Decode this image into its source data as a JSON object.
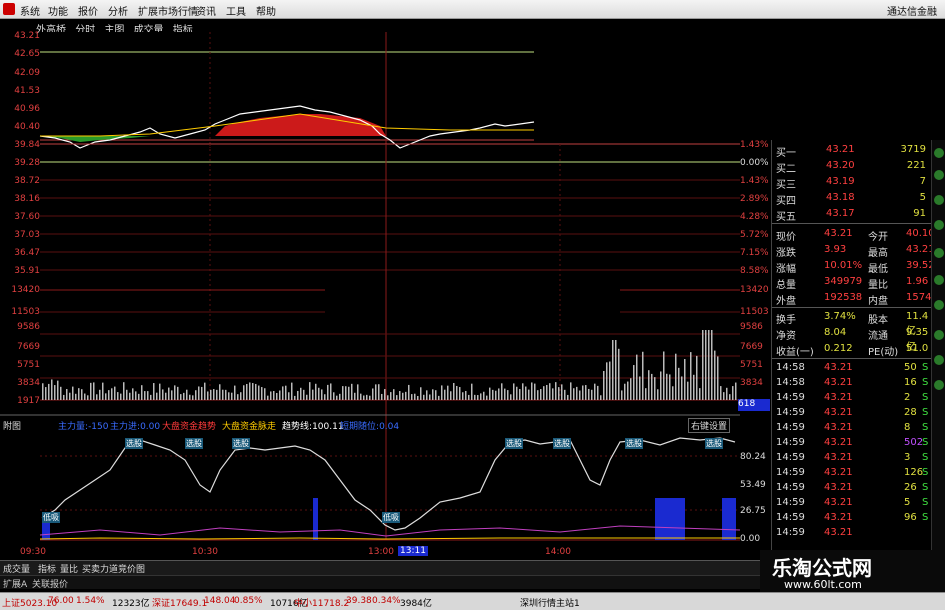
{
  "menu": {
    "items": [
      "系统",
      "功能",
      "报价",
      "分析",
      "扩展市场行情",
      "资讯",
      "工具",
      "帮助"
    ],
    "brand": "通达信金融"
  },
  "tabs": [
    "外高桥",
    "分时",
    "主图",
    "成交量",
    "指标"
  ],
  "price_axis": {
    "left": [
      "43.21",
      "42.65",
      "42.09",
      "41.53",
      "40.96",
      "40.40",
      "39.84",
      "39.28",
      "38.72",
      "38.16",
      "37.60",
      "37.03",
      "36.47",
      "35.91"
    ],
    "pct": [
      "1.43%",
      "0.00%",
      "1.43%",
      "2.89%",
      "4.28%",
      "5.72%",
      "7.15%",
      "8.58%"
    ]
  },
  "vol_axis": {
    "left": [
      "13420",
      "11503",
      "9586",
      "7669",
      "5751",
      "3834",
      "1917"
    ],
    "right": [
      "13420",
      "11503",
      "9586",
      "7669",
      "5751",
      "3834"
    ],
    "last": "618"
  },
  "indicator": {
    "title": "附图",
    "items": [
      {
        "label": "主力量",
        "value": "-150",
        "color": "#3a6cff"
      },
      {
        "label": "主力进",
        "value": "0.00",
        "color": "#3a6cff"
      },
      {
        "label": "大盘资金趋势",
        "value": "",
        "color": "#ff3a3a"
      },
      {
        "label": "大盘资金脉走",
        "value": "",
        "color": "#ffcc00"
      },
      {
        "label": "趋势线",
        "value": "100.11",
        "color": "#ffffff"
      },
      {
        "label": "短期随位",
        "value": "0.04",
        "color": "#3a6cff"
      }
    ],
    "right_btn": "右键设置",
    "axis": [
      "80.24",
      "53.49",
      "26.75",
      "0.00"
    ],
    "tags": [
      "选股",
      "选股",
      "选股",
      "选股",
      "选股",
      "选股",
      "选股",
      "低吸",
      "低吸"
    ]
  },
  "time_axis": [
    "09:30",
    "10:30",
    "13:00",
    "13:11",
    "14:00"
  ],
  "quote": {
    "bids": [
      {
        "label": "买一",
        "price": "43.21",
        "vol": "3719"
      },
      {
        "label": "买二",
        "price": "43.20",
        "vol": "221"
      },
      {
        "label": "买三",
        "price": "43.19",
        "vol": "7"
      },
      {
        "label": "买四",
        "price": "43.18",
        "vol": "5"
      },
      {
        "label": "买五",
        "price": "43.17",
        "vol": "91"
      }
    ],
    "stats": [
      {
        "a": "现价",
        "av": "43.21",
        "b": "今开",
        "bv": "40.10"
      },
      {
        "a": "涨跌",
        "av": "3.93",
        "b": "最高",
        "bv": "43.21"
      },
      {
        "a": "涨幅",
        "av": "10.01%",
        "b": "最低",
        "bv": "39.52"
      },
      {
        "a": "总量",
        "av": "349979",
        "b": "量比",
        "bv": "1.96"
      },
      {
        "a": "外盘",
        "av": "192538",
        "b": "内盘",
        "bv": "157441"
      },
      {
        "a": "换手",
        "av": "3.74%",
        "b": "股本",
        "bv": "11.4亿"
      },
      {
        "a": "净资",
        "av": "8.04",
        "b": "流通",
        "bv": "9.35亿"
      },
      {
        "a": "收益(一)",
        "av": "0.212",
        "b": "PE(动)",
        "bv": "51.0"
      }
    ],
    "ticks": [
      {
        "t": "14:58",
        "p": "43.21",
        "v": "50",
        "s": "S"
      },
      {
        "t": "14:58",
        "p": "43.21",
        "v": "16",
        "s": "S"
      },
      {
        "t": "14:59",
        "p": "43.21",
        "v": "2",
        "s": "S"
      },
      {
        "t": "14:59",
        "p": "43.21",
        "v": "28",
        "s": "S"
      },
      {
        "t": "14:59",
        "p": "43.21",
        "v": "8",
        "s": "S"
      },
      {
        "t": "14:59",
        "p": "43.21",
        "v": "502",
        "s": "S"
      },
      {
        "t": "14:59",
        "p": "43.21",
        "v": "3",
        "s": "S"
      },
      {
        "t": "14:59",
        "p": "43.21",
        "v": "126",
        "s": "S"
      },
      {
        "t": "14:59",
        "p": "43.21",
        "v": "26",
        "s": "S"
      },
      {
        "t": "14:59",
        "p": "43.21",
        "v": "5",
        "s": "S"
      },
      {
        "t": "14:59",
        "p": "43.21",
        "v": "96",
        "s": "S"
      },
      {
        "t": "14:59",
        "p": "43.21",
        "v": "",
        "s": ""
      }
    ]
  },
  "bottom_tabs": [
    "成交量",
    "指标",
    "量比",
    "买卖力道",
    "竞价图"
  ],
  "tabs2": [
    "扩展A",
    "关联报价"
  ],
  "status": [
    {
      "text": "上证5023.10",
      "c": "#c00000"
    },
    {
      "text": "76.00",
      "c": "#c00000"
    },
    {
      "text": "1.54%",
      "c": "#c00000"
    },
    {
      "text": "12323亿",
      "c": "#000"
    },
    {
      "text": "深证17649.1",
      "c": "#c00000"
    },
    {
      "text": "148.04",
      "c": "#c00000"
    },
    {
      "text": "0.85%",
      "c": "#c00000"
    },
    {
      "text": "10716亿",
      "c": "#000"
    },
    {
      "text": "中小11718.2",
      "c": "#c00000"
    },
    {
      "text": "39.38",
      "c": "#c00000"
    },
    {
      "text": "0.34%",
      "c": "#c00000"
    },
    {
      "text": "3984亿",
      "c": "#000"
    },
    {
      "text": "深圳行情主站1",
      "c": "#000"
    }
  ],
  "watermark": {
    "title": "乐淘公式网",
    "url": "www.60lt.com"
  }
}
